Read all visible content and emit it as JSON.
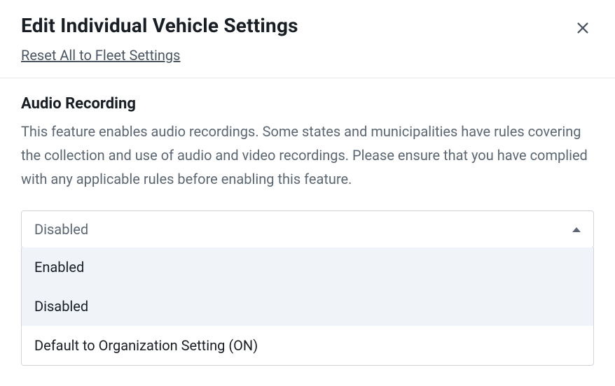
{
  "header": {
    "title": "Edit Individual Vehicle Settings",
    "reset_link": "Reset All to Fleet Settings"
  },
  "section": {
    "title": "Audio Recording",
    "description": "This feature enables audio recordings. Some states and municipalities have rules covering the collection and use of audio and video recordings. Please ensure that you have complied with any applicable rules before enabling this feature."
  },
  "select": {
    "selected_value": "Disabled",
    "options": [
      {
        "label": "Enabled",
        "highlighted": true
      },
      {
        "label": "Disabled",
        "highlighted": true
      },
      {
        "label": "Default to Organization Setting (ON)",
        "highlighted": false
      }
    ]
  }
}
